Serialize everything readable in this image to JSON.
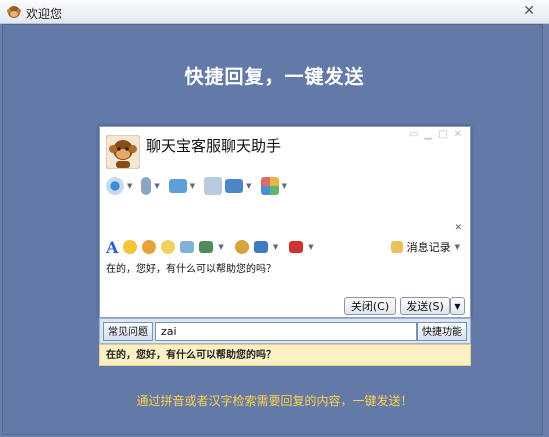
{
  "window": {
    "title": "欢迎您",
    "close_glyph": "✕"
  },
  "headline": "快捷回复，一键发送",
  "chat": {
    "name": "聊天宝客服聊天助手",
    "history_label": "消息记录",
    "message": "在的，您好，有什么可以帮助您的吗？",
    "close_button": "关闭(C)",
    "send_button": "发送(S)",
    "dropdown_glyph": "▼"
  },
  "quick": {
    "faq_button": "常见问题",
    "input_value": "zai",
    "quick_button": "快捷功能",
    "suggestion": "在的，您好，有什么可以帮助您的吗？"
  },
  "hint": "通过拼音或者汉字检索需要回复的内容，一键发送！",
  "colors": {
    "accent_blue": "#6379a8",
    "hint_yellow": "#ffd24a",
    "suggest_bg": "#fdf0c5"
  }
}
